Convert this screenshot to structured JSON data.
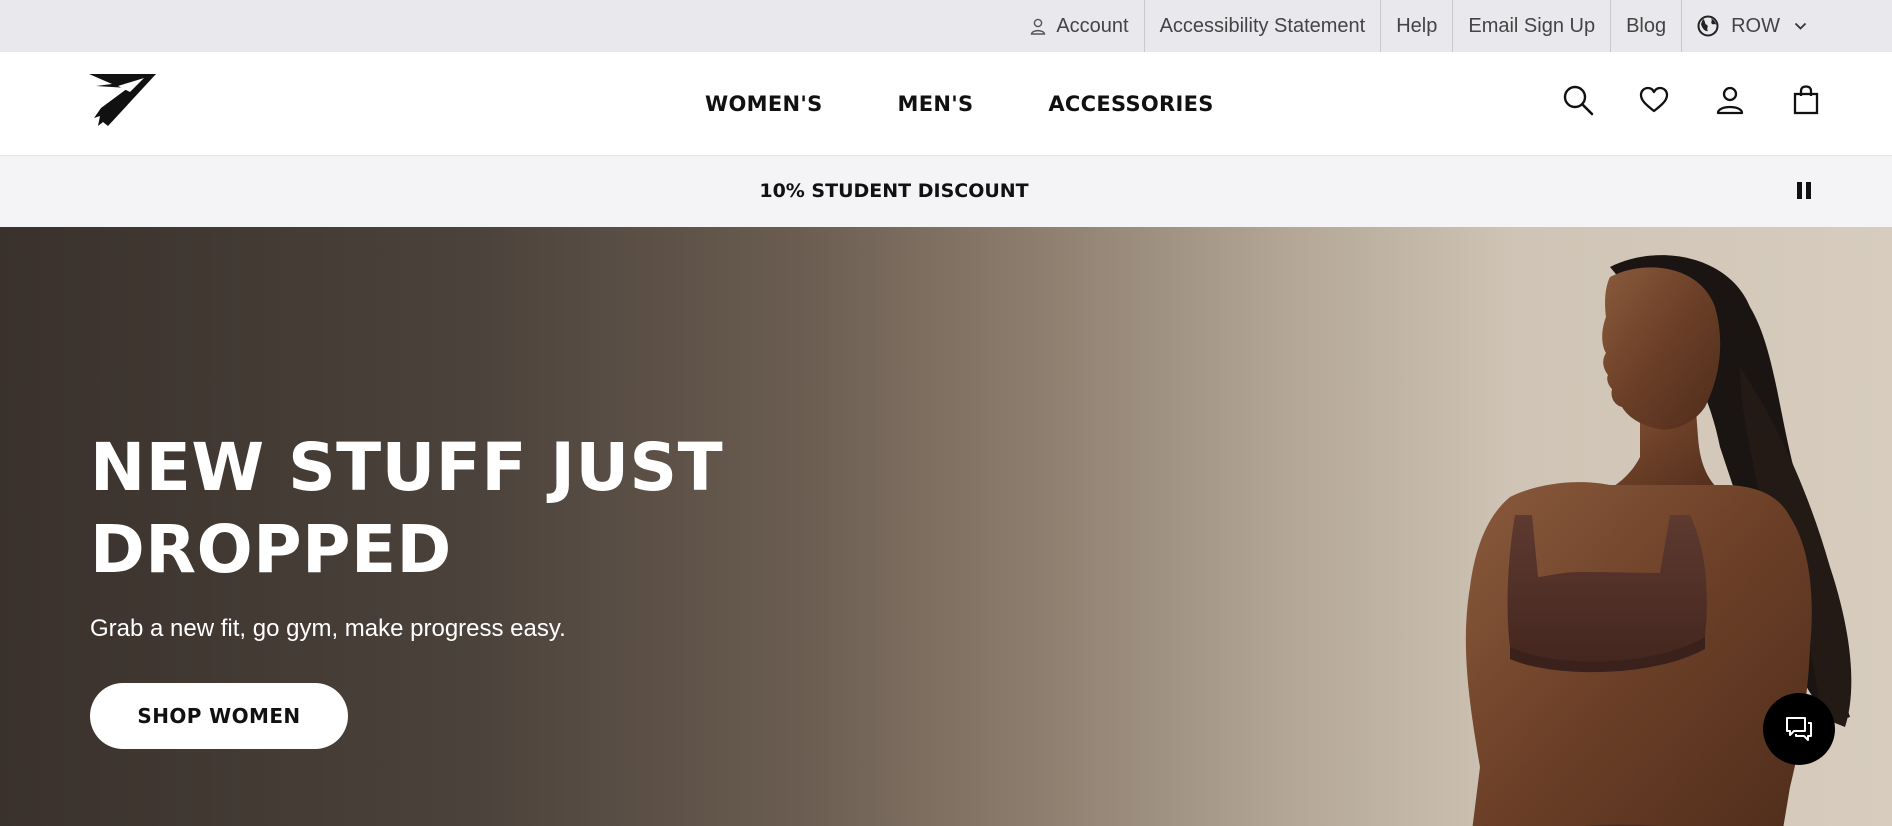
{
  "utility_bar": {
    "account_label": "Account",
    "accessibility_label": "Accessibility Statement",
    "help_label": "Help",
    "email_signup_label": "Email Sign Up",
    "blog_label": "Blog",
    "region_label": "ROW"
  },
  "header": {
    "logo_icon": "shark-logo-icon",
    "nav": {
      "womens": "WOMEN'S",
      "mens": "MEN'S",
      "accessories": "ACCESSORIES"
    },
    "icons": [
      "search-icon",
      "heart-icon",
      "account-icon",
      "bag-icon"
    ]
  },
  "promo": {
    "text": "10% STUDENT DISCOUNT",
    "control_icon": "pause-icon"
  },
  "hero": {
    "headline": "NEW STUFF JUST DROPPED",
    "subtext": "Grab a new fit, go gym, make progress easy.",
    "cta_label": "SHOP WOMEN",
    "image": "model-in-brown-sports-bra",
    "chat_icon": "chat-icon"
  },
  "colors": {
    "utility_bg": "#e9e8ec",
    "promo_bg": "#f4f3f6",
    "hero_dark": "#3a312c",
    "hero_light": "#d7ccbe",
    "text_primary": "#111111"
  }
}
